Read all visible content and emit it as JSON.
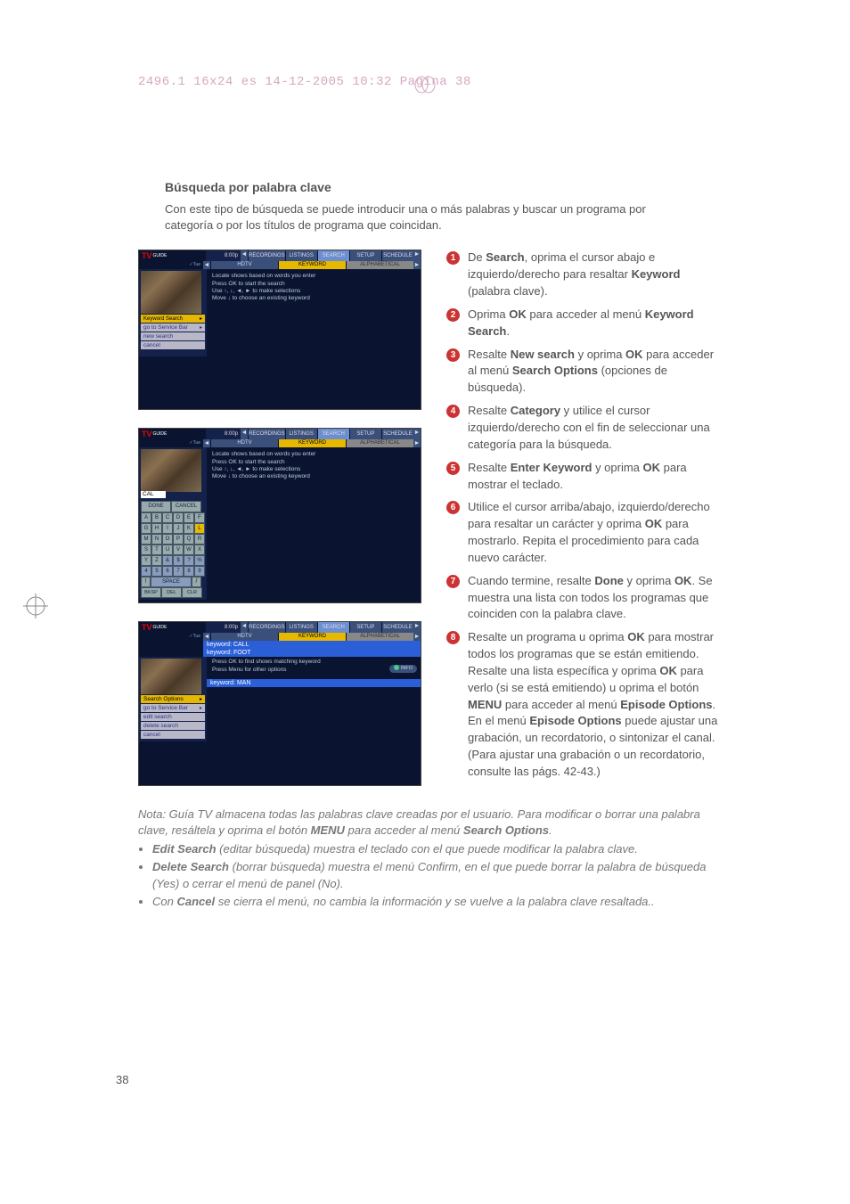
{
  "print_line": "2496.1 16x24 es  14-12-2005  10:32  Pagina 38",
  "section_title": "Búsqueda por palabra clave",
  "intro": "Con este tipo de búsqueda se puede introducir una o más palabras y buscar un programa por categoría o por los títulos de programa que coincidan.",
  "steps": [
    {
      "n": "1",
      "t": "De <b>Search</b>, oprima el cursor abajo e izquierdo/derecho para resaltar <b>Keyword</b> (palabra clave)."
    },
    {
      "n": "2",
      "t": "Oprima <b>OK</b> para acceder al menú <b>Keyword Search</b>."
    },
    {
      "n": "3",
      "t": "Resalte <b>New search</b> y oprima <b>OK</b> para acceder al menú <b>Search Options</b> (opciones de búsqueda)."
    },
    {
      "n": "4",
      "t": "Resalte <b>Category</b> y utilice el cursor izquierdo/derecho con el fin de seleccionar una categoría para la búsqueda."
    },
    {
      "n": "5",
      "t": "Resalte <b>Enter Keyword</b> y oprima <b>OK</b> para mostrar el teclado."
    },
    {
      "n": "6",
      "t": "Utilice el cursor arriba/abajo, izquierdo/derecho para resaltar un carácter y oprima <b>OK</b> para mostrarlo. Repita el procedimiento para cada nuevo carácter."
    },
    {
      "n": "7",
      "t": "Cuando termine, resalte <b>Done</b> y oprima <b>OK</b>. Se muestra una lista con todos los programas que coinciden con la palabra clave."
    },
    {
      "n": "8",
      "t": "Resalte un programa u oprima <b>OK</b> para mostrar todos los programas que se están emitiendo.<br>Resalte una lista específica y oprima <b>OK</b> para verlo (si se está emitiendo) u oprima el botón <b>MENU</b> para acceder al menú <b>Episode Options</b>. En el menú <b>Episode Options</b> puede ajustar una grabación, un recordatorio, o sintonizar el canal. (Para ajustar una grabación o un recordatorio, consulte las págs. 42-43.)"
    }
  ],
  "note_lead": "Nota: Guía TV almacena todas las palabras clave creadas por el usuario. Para modificar o borrar una palabra clave, resáltela y oprima el botón <b>MENU</b> para acceder al menú <b>Search Options</b>.",
  "note_items": [
    "<b>Edit Search</b> (editar búsqueda) muestra el teclado con el que puede modificar la palabra clave.",
    "<b>Delete Search</b> (borrar búsqueda) muestra el menú Confirm, en el que puede borrar la palabra de búsqueda (Yes) o cerrar el menú de panel (No).",
    "Con <b>Cancel</b> se cierra el menú, no cambia la información y se vuelve a la palabra clave resaltada.."
  ],
  "page_number": "38",
  "tv_guide": {
    "logo_tv": "TV",
    "logo_guide": "GUIDE",
    "time": "8:00p",
    "tabs": [
      "RECORDINGS",
      "LISTINGS",
      "SEARCH",
      "SETUP",
      "SCHEDULE"
    ],
    "subtabs": [
      "HDTV",
      "KEYWORD",
      "ALPHABETICAL"
    ],
    "help": [
      "Locate shows based on words you enter",
      "Press OK to start the search",
      "Use ↑, ↓, ◄, ► to make selections",
      "Move ↓ to choose an existing keyword"
    ],
    "ss1_caption": "Keyword Search",
    "ss1_menu": [
      "go to Service Bar",
      "new search",
      "cancel"
    ],
    "kb_input": "CAL",
    "kb_done": "DONE",
    "kb_cancel": "CANCEL",
    "kb_rows": [
      [
        "A",
        "B",
        "C",
        "D",
        "E",
        "F"
      ],
      [
        "G",
        "H",
        "I",
        "J",
        "K",
        "L"
      ],
      [
        "M",
        "N",
        "O",
        "P",
        "Q",
        "R"
      ],
      [
        "S",
        "T",
        "U",
        "V",
        "W",
        "X"
      ],
      [
        "Y",
        "Z",
        "&",
        "$",
        "?",
        "%"
      ],
      [
        "4",
        "5",
        "6",
        "7",
        "8",
        "9"
      ]
    ],
    "kb_space": "SPACE",
    "kb_bottom": [
      "BKSP",
      "DEL",
      "CLR"
    ],
    "ss3_keywords": [
      "keyword: CALL",
      "keyword: FOOT"
    ],
    "ss3_main_keyword": "keyword: MAN",
    "ss3_help": [
      "Press OK to find shows matching keyword",
      "Press Menu for other options"
    ],
    "ss3_caption": "Search Options",
    "ss3_menu": [
      "go to Service Bar",
      "edit search",
      "delete search",
      "cancel"
    ],
    "info_label": "INFO"
  }
}
